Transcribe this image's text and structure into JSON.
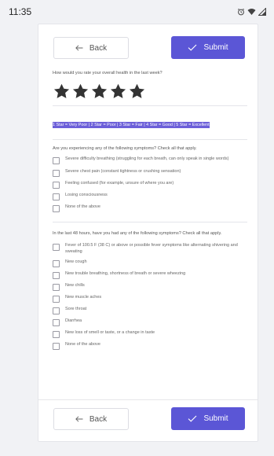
{
  "status_bar": {
    "time": "11:35",
    "icons": [
      "alarm-icon",
      "wifi-icon",
      "signal-icon"
    ]
  },
  "nav": {
    "back_label": "Back",
    "submit_label": "Submit"
  },
  "rating": {
    "question": "How would you rate your overall health in the last week?",
    "stars_selected": 5,
    "stars_total": 5,
    "legend": "1 Star = Very Poor | 2 Star = Poor | 3 Star = Fair | 4 Star = Good | 5 Star = Excellent"
  },
  "symptoms_now": {
    "question": "Are you experiencing any of the following symptoms? Check all that apply.",
    "options": [
      "Severe difficulty breathing (struggling for each breath, can only speak in single words)",
      "Severe chest pain (constant tightness or crushing sensation)",
      "Feeling confused (for example, unsure of where you are)",
      "Losing consciousness",
      "None of the above"
    ]
  },
  "symptoms_48h": {
    "question": "In the last 48 hours, have you had any of the following symptoms? Check all that apply.",
    "options": [
      "Fever of 100.5 F (38 C) or above or possible fever symptoms like alternating shivering and sweating",
      "New cough",
      "New trouble breathing, shortness of breath or severe wheezing",
      "New chills",
      "New muscle aches",
      "Sore throat",
      "Diarrhea",
      "New loss of smell or taste, or a change in taste",
      "None of the above"
    ]
  },
  "colors": {
    "primary": "#5b56d6",
    "legend_bg": "#6c5fd9",
    "star": "#333333"
  }
}
